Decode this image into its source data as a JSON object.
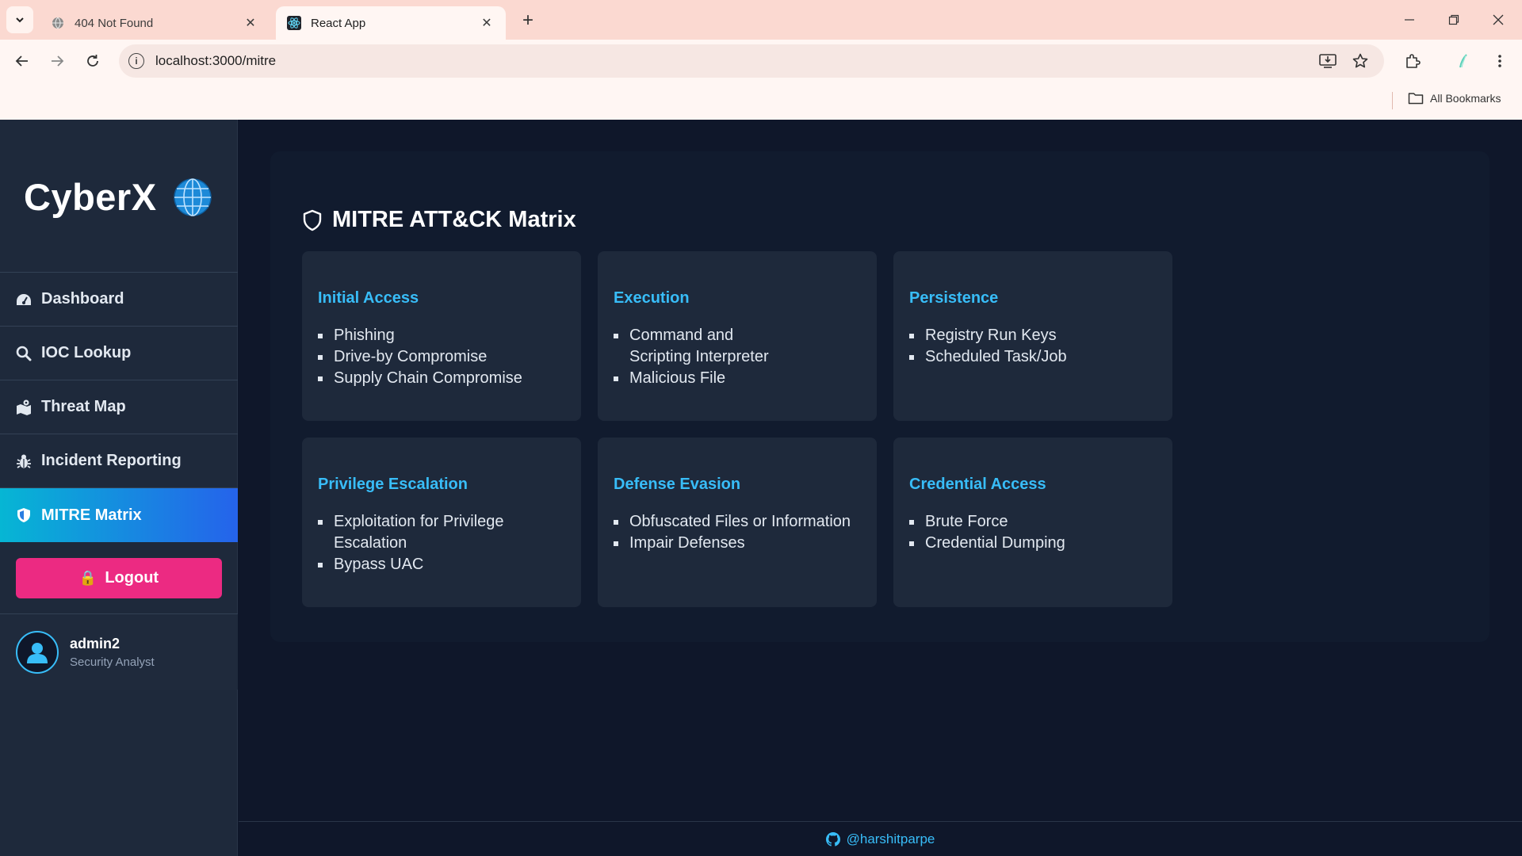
{
  "browser": {
    "tabs": [
      {
        "title": "404 Not Found",
        "favicon": "globe-icon",
        "active": false
      },
      {
        "title": "React App",
        "favicon": "react-icon",
        "active": true
      }
    ],
    "url": "localhost:3000/mitre",
    "bookmarks_label": "All Bookmarks"
  },
  "sidebar": {
    "brand": "CyberX",
    "brand_icon": "globe-icon",
    "items": [
      {
        "label": "Dashboard",
        "icon": "gauge-icon"
      },
      {
        "label": "IOC Lookup",
        "icon": "search-icon"
      },
      {
        "label": "Threat Map",
        "icon": "map-icon"
      },
      {
        "label": "Incident Reporting",
        "icon": "bug-icon"
      },
      {
        "label": "MITRE Matrix",
        "icon": "shield-icon",
        "active": true
      }
    ],
    "logout_label": "Logout",
    "user": {
      "name": "admin2",
      "role": "Security Analyst"
    }
  },
  "main": {
    "title": "MITRE ATT&CK Matrix",
    "tactics": [
      {
        "name": "Initial Access",
        "techniques": [
          "Phishing",
          "Drive-by Compromise",
          "Supply Chain Compromise"
        ]
      },
      {
        "name": "Execution",
        "techniques": [
          "Command and Scripting Interpreter",
          "Malicious File"
        ]
      },
      {
        "name": "Persistence",
        "techniques": [
          "Registry Run Keys",
          "Scheduled Task/Job"
        ]
      },
      {
        "name": "Privilege Escalation",
        "techniques": [
          "Exploitation for Privilege Escalation",
          "Bypass UAC"
        ]
      },
      {
        "name": "Defense Evasion",
        "techniques": [
          "Obfuscated Files or Information",
          "Impair Defenses"
        ]
      },
      {
        "name": "Credential Access",
        "techniques": [
          "Brute Force",
          "Credential Dumping"
        ]
      }
    ]
  },
  "footer": {
    "handle": "@harshitparpe",
    "icon": "github-icon"
  },
  "colors": {
    "accent": "#38bdf8",
    "active_gradient_start": "#06b6d4",
    "active_gradient_end": "#2563eb",
    "logout": "#ec2a82",
    "background": "#0f172a",
    "card": "#1e293b"
  }
}
